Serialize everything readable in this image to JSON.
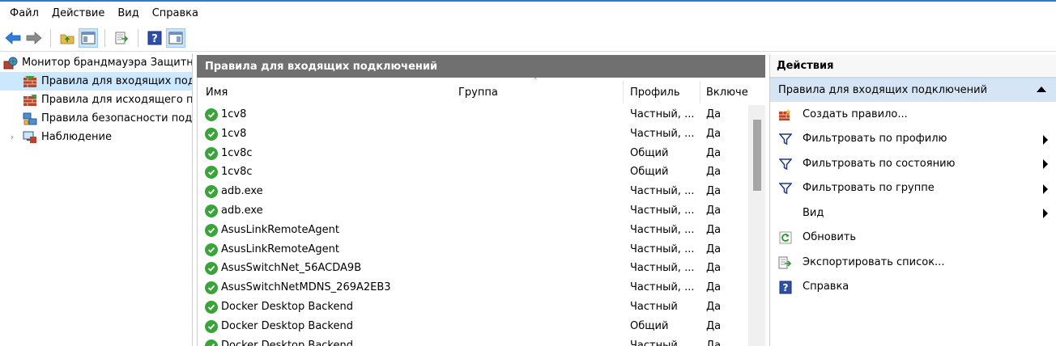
{
  "menu": [
    "Файл",
    "Действие",
    "Вид",
    "Справка"
  ],
  "toolbar": {
    "icons": [
      "back-arrow-icon",
      "forward-arrow-icon",
      "folder-up-icon",
      "show-hide-tree-icon",
      "export-icon",
      "help-icon",
      "show-hide-action-pane-icon"
    ]
  },
  "tree": {
    "root": "Монитор брандмауэра Защитника Windows в режиме повышенной безопасности",
    "items": [
      {
        "label": "Правила для входящих подключений"
      },
      {
        "label": "Правила для исходящего подключения"
      },
      {
        "label": "Правила безопасности подключений"
      },
      {
        "label": "Наблюдение"
      }
    ]
  },
  "center": {
    "title": "Правила для входящих подключений",
    "columns": {
      "name": "Имя",
      "group": "Группа",
      "profile": "Профиль",
      "enabled": "Включено"
    },
    "rows": [
      {
        "name": "1cv8",
        "group": "",
        "profile": "Частный, ...",
        "enabled": "Да"
      },
      {
        "name": "1cv8",
        "group": "",
        "profile": "Частный, ...",
        "enabled": "Да"
      },
      {
        "name": "1cv8c",
        "group": "",
        "profile": "Общий",
        "enabled": "Да"
      },
      {
        "name": "1cv8c",
        "group": "",
        "profile": "Общий",
        "enabled": "Да"
      },
      {
        "name": "adb.exe",
        "group": "",
        "profile": "Частный, ...",
        "enabled": "Да"
      },
      {
        "name": "adb.exe",
        "group": "",
        "profile": "Частный, ...",
        "enabled": "Да"
      },
      {
        "name": "AsusLinkRemoteAgent",
        "group": "",
        "profile": "Частный, ...",
        "enabled": "Да"
      },
      {
        "name": "AsusLinkRemoteAgent",
        "group": "",
        "profile": "Частный, ...",
        "enabled": "Да"
      },
      {
        "name": "AsusSwitchNet_56ACDA9B",
        "group": "",
        "profile": "Частный, ...",
        "enabled": "Да"
      },
      {
        "name": "AsusSwitchNetMDNS_269A2EB3",
        "group": "",
        "profile": "Частный, ...",
        "enabled": "Да"
      },
      {
        "name": "Docker Desktop Backend",
        "group": "",
        "profile": "Частный",
        "enabled": "Да"
      },
      {
        "name": "Docker Desktop Backend",
        "group": "",
        "profile": "Общий",
        "enabled": "Да"
      },
      {
        "name": "Docker Desktop Backend",
        "group": "",
        "profile": "Частный",
        "enabled": "Да"
      }
    ]
  },
  "actions": {
    "title": "Действия",
    "section": "Правила для входящих подключений",
    "items": [
      {
        "label": "Создать правило...",
        "icon": "new-rule-icon",
        "submenu": false
      },
      {
        "label": "Фильтровать по профилю",
        "icon": "filter-icon",
        "submenu": true
      },
      {
        "label": "Фильтровать по состоянию",
        "icon": "filter-icon",
        "submenu": true
      },
      {
        "label": "Фильтровать по группе",
        "icon": "filter-icon",
        "submenu": true
      },
      {
        "label": "Вид",
        "icon": "",
        "submenu": true
      },
      {
        "label": "Обновить",
        "icon": "refresh-icon",
        "submenu": false
      },
      {
        "label": "Экспортировать список...",
        "icon": "export-list-icon",
        "submenu": false
      },
      {
        "label": "Справка",
        "icon": "help-icon",
        "submenu": false
      }
    ]
  }
}
